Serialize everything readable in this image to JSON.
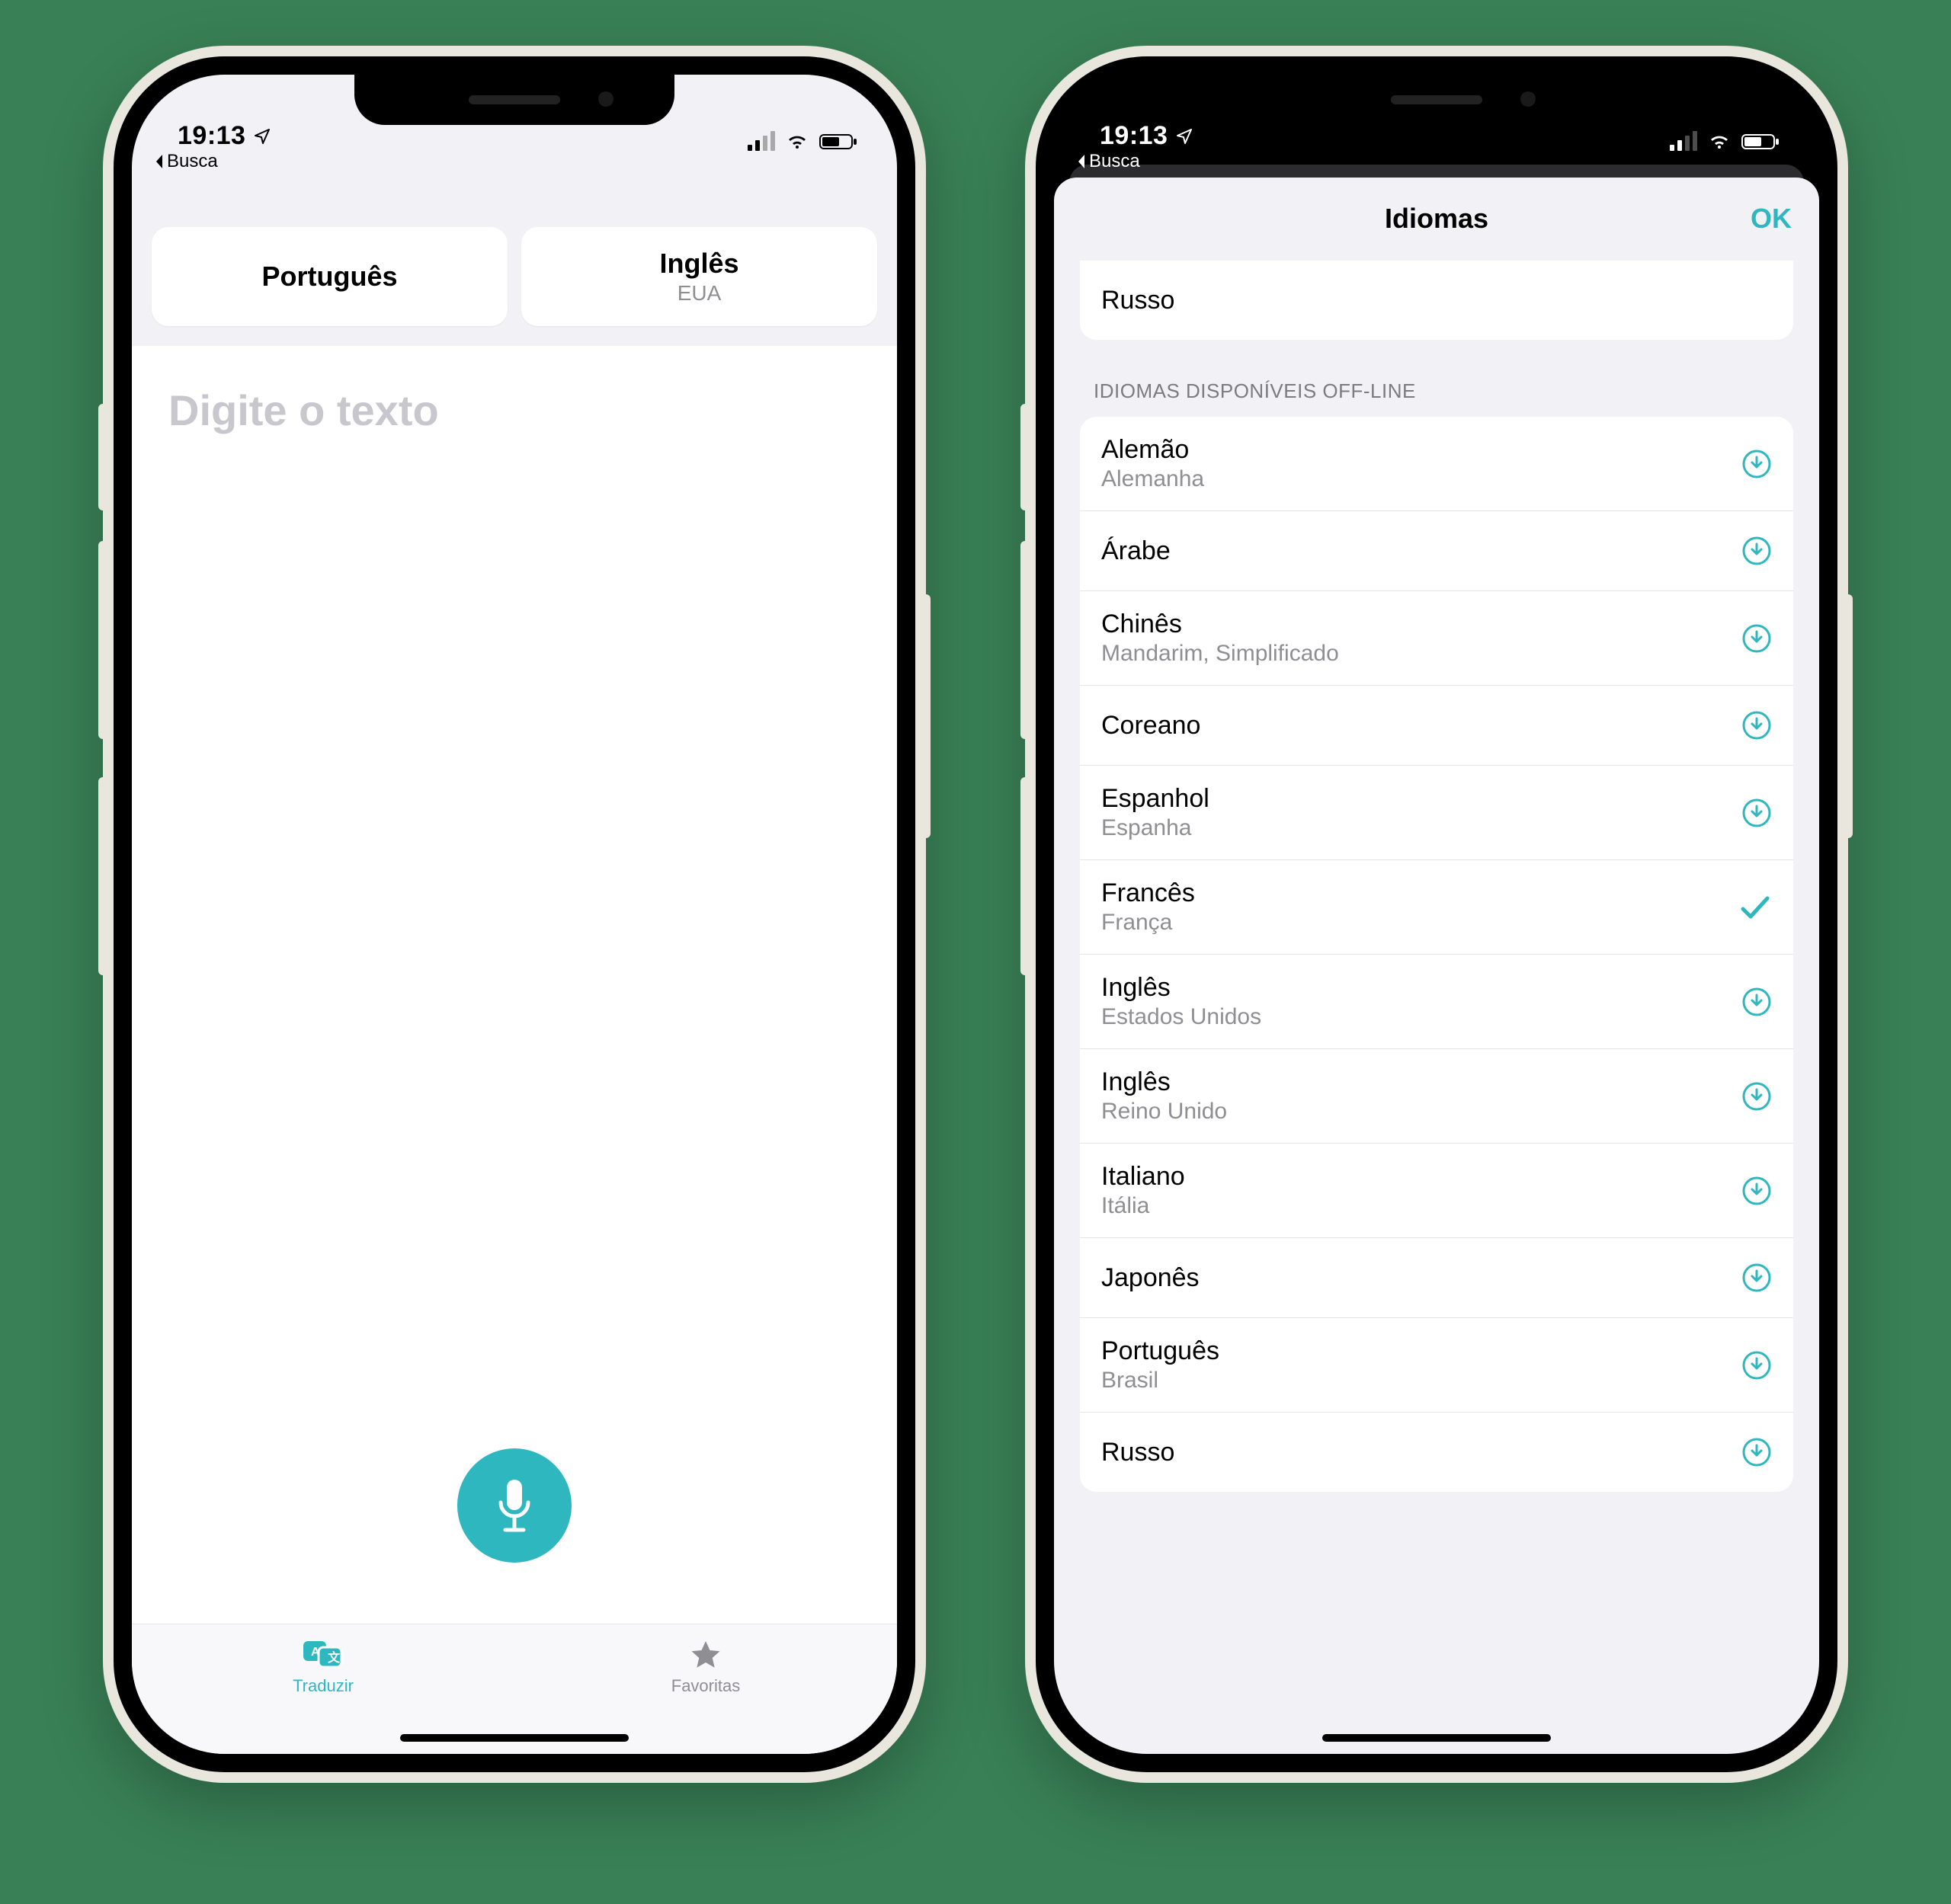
{
  "status": {
    "time": "19:13",
    "back_app": "Busca"
  },
  "left": {
    "source_lang": {
      "name": "Português",
      "sub": ""
    },
    "target_lang": {
      "name": "Inglês",
      "sub": "EUA"
    },
    "placeholder": "Digite o texto",
    "tabs": {
      "translate": "Traduzir",
      "favorites": "Favoritas"
    }
  },
  "right": {
    "sheet_title": "Idiomas",
    "ok": "OK",
    "top_row": {
      "name": "Russo"
    },
    "offline_header": "IDIOMAS DISPONÍVEIS OFF-LINE",
    "languages": [
      {
        "name": "Alemão",
        "sub": "Alemanha",
        "state": "download"
      },
      {
        "name": "Árabe",
        "sub": "",
        "state": "download"
      },
      {
        "name": "Chinês",
        "sub": "Mandarim, Simplificado",
        "state": "download"
      },
      {
        "name": "Coreano",
        "sub": "",
        "state": "download"
      },
      {
        "name": "Espanhol",
        "sub": "Espanha",
        "state": "download"
      },
      {
        "name": "Francês",
        "sub": "França",
        "state": "selected"
      },
      {
        "name": "Inglês",
        "sub": "Estados Unidos",
        "state": "download"
      },
      {
        "name": "Inglês",
        "sub": "Reino Unido",
        "state": "download"
      },
      {
        "name": "Italiano",
        "sub": "Itália",
        "state": "download"
      },
      {
        "name": "Japonês",
        "sub": "",
        "state": "download"
      },
      {
        "name": "Português",
        "sub": "Brasil",
        "state": "download"
      },
      {
        "name": "Russo",
        "sub": "",
        "state": "download"
      }
    ]
  },
  "colors": {
    "accent": "#2fb7c0"
  }
}
